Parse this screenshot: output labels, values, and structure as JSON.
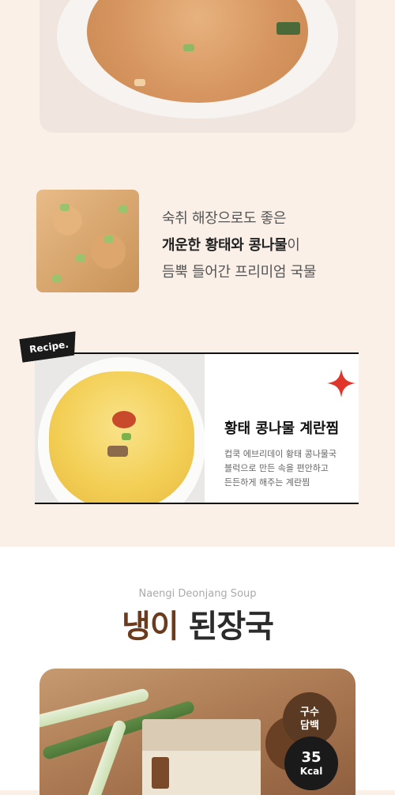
{
  "description": {
    "line1": "숙취 해장으로도 좋은",
    "line2_bold": "개운한 황태와 콩나물",
    "line2_rest": "이",
    "line3": "듬뿍 들어간 프리미엄 국물"
  },
  "recipe": {
    "tag": "Recipe.",
    "title": "황태 콩나물 계란찜",
    "lines": [
      "컵쿡 에브리데이 황태 콩나물국",
      "블럭으로 만든 속을 편안하고",
      "든든하게 해주는 계란찜"
    ]
  },
  "section": {
    "subtitle": "Naengi Deonjang Soup",
    "title_accent": "냉이",
    "title_rest": "된장국"
  },
  "badges": {
    "protein_line1": "구수",
    "protein_line2": "담백",
    "kcal_value": "35",
    "kcal_unit": "Kcal"
  },
  "colors": {
    "background": "#fbf0e8",
    "accent_brown": "#6b3b1d",
    "sparkle_red": "#e0352b"
  }
}
